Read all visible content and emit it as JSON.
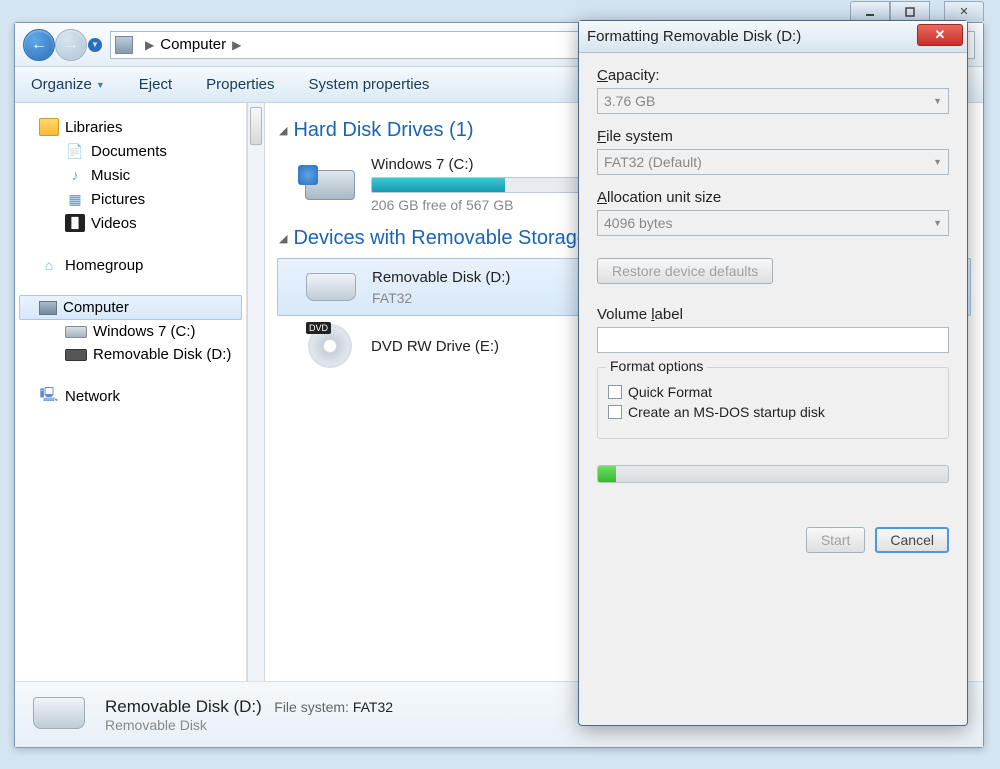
{
  "breadcrumb": {
    "root": "Computer"
  },
  "toolbar": {
    "organize": "Organize",
    "eject": "Eject",
    "properties": "Properties",
    "system_properties": "System properties"
  },
  "sidebar": {
    "libraries": {
      "label": "Libraries",
      "documents": "Documents",
      "music": "Music",
      "pictures": "Pictures",
      "videos": "Videos"
    },
    "homegroup": "Homegroup",
    "computer": {
      "label": "Computer",
      "c": "Windows 7 (C:)",
      "d": "Removable Disk (D:)"
    },
    "network": "Network"
  },
  "content": {
    "group_hdd": "Hard Disk Drives (1)",
    "hdd": {
      "title": "Windows 7 (C:)",
      "free": "206 GB free of 567 GB"
    },
    "group_removable": "Devices with Removable Storage",
    "removable": {
      "title": "Removable Disk (D:)",
      "fs": "FAT32"
    },
    "dvd": {
      "title": "DVD RW Drive (E:)"
    }
  },
  "details": {
    "title": "Removable Disk (D:)",
    "meta_label": "File system:",
    "meta_value": "FAT32",
    "subtitle": "Removable Disk"
  },
  "dialog": {
    "title": "Formatting Removable Disk (D:)",
    "capacity_label": "Capacity:",
    "capacity_value": "3.76 GB",
    "fs_label": "File system",
    "fs_value": "FAT32 (Default)",
    "alloc_label": "Allocation unit size",
    "alloc_value": "4096 bytes",
    "restore": "Restore device defaults",
    "volume_label": "Volume label",
    "volume_value": "",
    "options_legend": "Format options",
    "quick": "Quick Format",
    "msdos": "Create an MS-DOS startup disk",
    "start": "Start",
    "cancel": "Cancel"
  }
}
